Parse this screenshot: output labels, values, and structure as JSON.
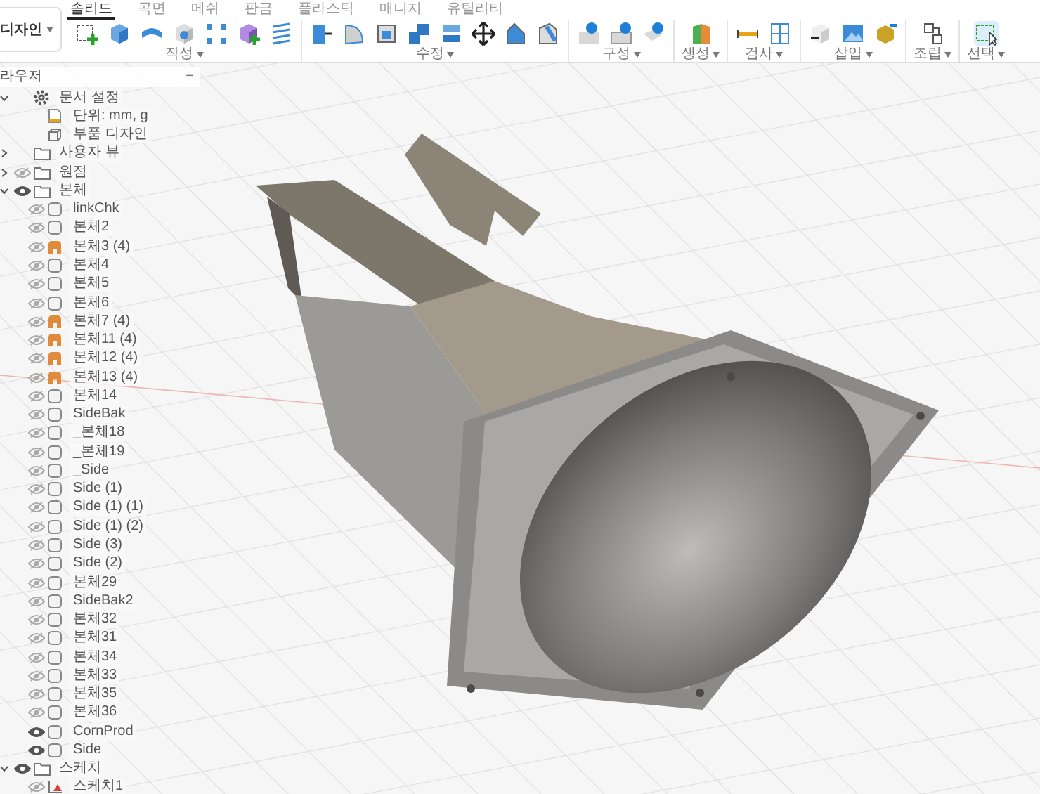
{
  "toolbar": {
    "workspace": "디자인",
    "tabs": [
      {
        "label": "솔리드",
        "selected": true
      },
      {
        "label": "곡면",
        "selected": false
      },
      {
        "label": "메쉬",
        "selected": false
      },
      {
        "label": "판금",
        "selected": false
      },
      {
        "label": "플라스틱",
        "selected": false
      },
      {
        "label": "매니지",
        "selected": false
      },
      {
        "label": "유틸리티",
        "selected": false
      }
    ],
    "groups": [
      {
        "label": "작성",
        "kind": "create"
      },
      {
        "label": "수정",
        "kind": "modify"
      },
      {
        "label": "구성",
        "kind": "construct"
      },
      {
        "label": "생성",
        "kind": "make"
      },
      {
        "label": "검사",
        "kind": "inspect"
      },
      {
        "label": "삽입",
        "kind": "insert"
      },
      {
        "label": "조립",
        "kind": "assemble"
      },
      {
        "label": "선택",
        "kind": "select"
      }
    ]
  },
  "browser": {
    "title": "라우저",
    "collapse": "−",
    "tree": [
      {
        "label": "문서 설정",
        "kind": "settings",
        "expanded": true,
        "children": [
          {
            "label": "단위: mm, g",
            "kind": "units"
          },
          {
            "label": "부품 디자인",
            "kind": "design"
          }
        ]
      },
      {
        "label": "사용자 뷰",
        "kind": "folder",
        "expanded": false
      },
      {
        "label": "원점",
        "kind": "folder",
        "expanded": false,
        "visible": false
      },
      {
        "label": "본체",
        "kind": "folder",
        "expanded": true,
        "visible": true,
        "children": [
          {
            "label": "linkChk",
            "kind": "body",
            "visible": false
          },
          {
            "label": "본체2",
            "kind": "body",
            "visible": false
          },
          {
            "label": "본체3 (4)",
            "kind": "component",
            "visible": false
          },
          {
            "label": "본체4",
            "kind": "body",
            "visible": false
          },
          {
            "label": "본체5",
            "kind": "body",
            "visible": false
          },
          {
            "label": "본체6",
            "kind": "body",
            "visible": false
          },
          {
            "label": "본체7 (4)",
            "kind": "component",
            "visible": false
          },
          {
            "label": "본체11 (4)",
            "kind": "component",
            "visible": false
          },
          {
            "label": "본체12 (4)",
            "kind": "component",
            "visible": false
          },
          {
            "label": "본체13 (4)",
            "kind": "component",
            "visible": false
          },
          {
            "label": "본체14",
            "kind": "body",
            "visible": false
          },
          {
            "label": "SideBak",
            "kind": "body",
            "visible": false
          },
          {
            "label": "_본체18",
            "kind": "body",
            "visible": false
          },
          {
            "label": "_본체19",
            "kind": "body",
            "visible": false
          },
          {
            "label": "_Side",
            "kind": "body",
            "visible": false
          },
          {
            "label": "Side (1)",
            "kind": "body",
            "visible": false
          },
          {
            "label": "Side (1) (1)",
            "kind": "body",
            "visible": false
          },
          {
            "label": "Side (1) (2)",
            "kind": "body",
            "visible": false
          },
          {
            "label": "Side (3)",
            "kind": "body",
            "visible": false
          },
          {
            "label": "Side (2)",
            "kind": "body",
            "visible": false
          },
          {
            "label": "본체29",
            "kind": "body",
            "visible": false
          },
          {
            "label": "SideBak2",
            "kind": "body",
            "visible": false
          },
          {
            "label": "본체32",
            "kind": "body",
            "visible": false
          },
          {
            "label": "본체31",
            "kind": "body",
            "visible": false
          },
          {
            "label": "본체34",
            "kind": "body",
            "visible": false
          },
          {
            "label": "본체33",
            "kind": "body",
            "visible": false
          },
          {
            "label": "본체35",
            "kind": "body",
            "visible": false
          },
          {
            "label": "본체36",
            "kind": "body",
            "visible": false
          },
          {
            "label": "CornProd",
            "kind": "body",
            "visible": true
          },
          {
            "label": "Side",
            "kind": "body",
            "visible": true
          }
        ]
      },
      {
        "label": "스케치",
        "kind": "folder",
        "expanded": true,
        "visible": true,
        "children": [
          {
            "label": "스케치1",
            "kind": "sketch",
            "visible": false
          }
        ]
      }
    ]
  }
}
